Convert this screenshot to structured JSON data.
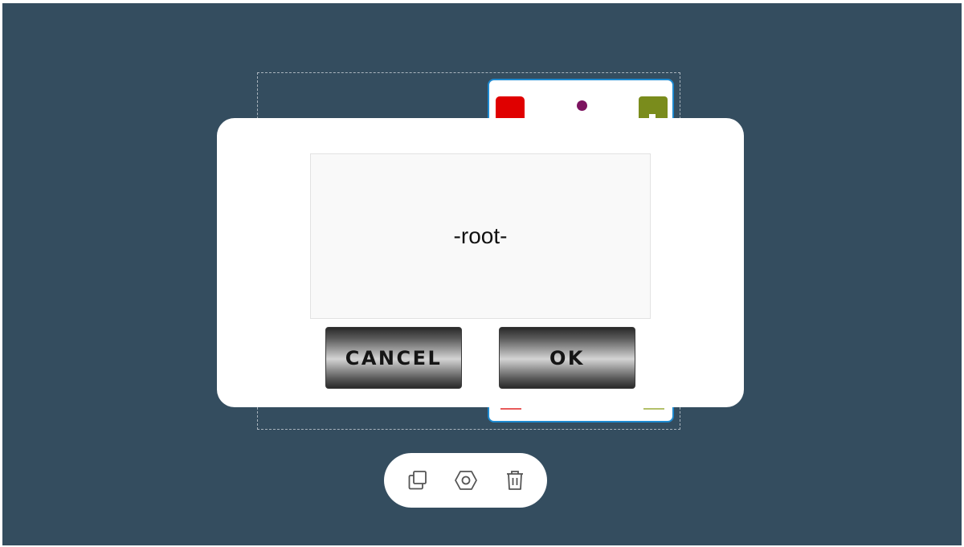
{
  "dialog": {
    "text_value": "-root-",
    "cancel_label": "CANCEL",
    "ok_label": "OK"
  },
  "background_card": {
    "colors": {
      "red_block": "#e00000",
      "green_block": "#7a8c1c",
      "dot": "#7d1460",
      "border": "#1e8ad0"
    }
  },
  "toolbar": {
    "icons": [
      "duplicate-icon",
      "settings-icon",
      "trash-icon"
    ]
  },
  "colors": {
    "canvas_background": "#344d5f",
    "dialog_background": "#ffffff"
  }
}
